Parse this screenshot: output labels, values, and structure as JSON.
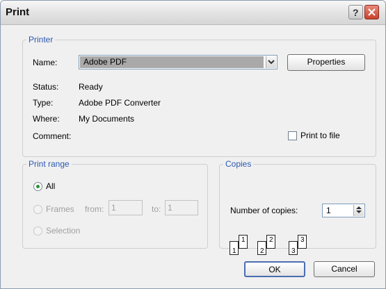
{
  "window": {
    "title": "Print"
  },
  "printer": {
    "legend": "Printer",
    "name_label": "Name:",
    "name_value": "Adobe PDF",
    "properties_label": "Properties",
    "status_label": "Status:",
    "status_value": "Ready",
    "type_label": "Type:",
    "type_value": "Adobe PDF Converter",
    "where_label": "Where:",
    "where_value": "My Documents",
    "comment_label": "Comment:",
    "print_to_file_label": "Print to file"
  },
  "print_range": {
    "legend": "Print range",
    "all_label": "All",
    "frames_label": "Frames",
    "from_label": "from:",
    "from_value": "1",
    "to_label": "to:",
    "to_value": "1",
    "selection_label": "Selection"
  },
  "copies": {
    "legend": "Copies",
    "number_label": "Number of copies:",
    "number_value": "1",
    "collate_pages": [
      "1",
      "1",
      "2",
      "2",
      "3",
      "3"
    ]
  },
  "buttons": {
    "ok": "OK",
    "cancel": "Cancel"
  },
  "icons": {
    "help": "help-icon",
    "close": "close-icon",
    "dropdown": "chevron-down-icon",
    "spinner": "spinner-arrows-icon"
  },
  "colors": {
    "legend": "#2b58b3",
    "close": "#c9412c",
    "selected_radio": "#2d8f33"
  }
}
